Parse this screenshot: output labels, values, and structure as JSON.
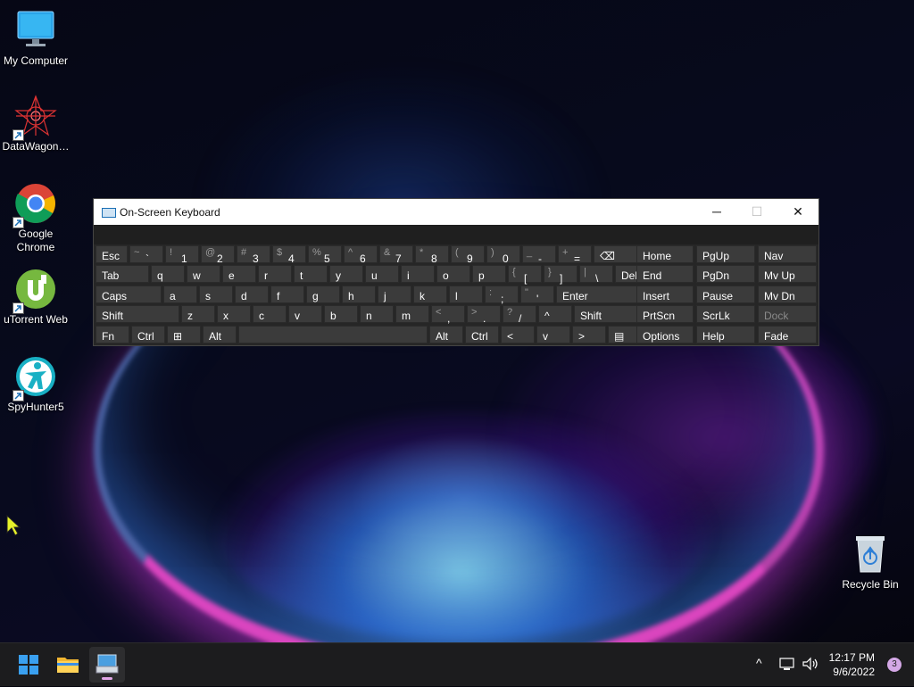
{
  "desktop": {
    "icons": [
      {
        "label": "My Computer",
        "icon": "monitor-icon"
      },
      {
        "label": "DataWagon…",
        "icon": "datawagon-icon"
      },
      {
        "label": "Google Chrome",
        "icon": "chrome-icon"
      },
      {
        "label": "uTorrent Web",
        "icon": "utorrent-icon"
      },
      {
        "label": "SpyHunter5",
        "icon": "spyhunter-icon"
      },
      {
        "label": "Recycle Bin",
        "icon": "recycle-bin-icon"
      }
    ]
  },
  "osk": {
    "title": "On-Screen Keyboard",
    "controls": {
      "minimize": "─",
      "maximize": "☐",
      "close": "✕"
    },
    "rows": {
      "r1": [
        {
          "label": "Esc"
        },
        {
          "shift": "~",
          "main": "`"
        },
        {
          "shift": "!",
          "main": "1"
        },
        {
          "shift": "@",
          "main": "2"
        },
        {
          "shift": "#",
          "main": "3"
        },
        {
          "shift": "$",
          "main": "4"
        },
        {
          "shift": "%",
          "main": "5"
        },
        {
          "shift": "^",
          "main": "6"
        },
        {
          "shift": "&",
          "main": "7"
        },
        {
          "shift": "*",
          "main": "8"
        },
        {
          "shift": "(",
          "main": "9"
        },
        {
          "shift": ")",
          "main": "0"
        },
        {
          "shift": "_",
          "main": "-"
        },
        {
          "shift": "+",
          "main": "="
        },
        {
          "label": "⌫"
        }
      ],
      "r2": [
        {
          "label": "Tab"
        },
        {
          "label": "q"
        },
        {
          "label": "w"
        },
        {
          "label": "e"
        },
        {
          "label": "r"
        },
        {
          "label": "t"
        },
        {
          "label": "y"
        },
        {
          "label": "u"
        },
        {
          "label": "i"
        },
        {
          "label": "o"
        },
        {
          "label": "p"
        },
        {
          "shift": "{",
          "main": "["
        },
        {
          "shift": "}",
          "main": "]"
        },
        {
          "shift": "|",
          "main": "\\"
        },
        {
          "label": "Del"
        }
      ],
      "r3": [
        {
          "label": "Caps"
        },
        {
          "label": "a"
        },
        {
          "label": "s"
        },
        {
          "label": "d"
        },
        {
          "label": "f"
        },
        {
          "label": "g"
        },
        {
          "label": "h"
        },
        {
          "label": "j"
        },
        {
          "label": "k"
        },
        {
          "label": "l"
        },
        {
          "shift": ":",
          "main": ";"
        },
        {
          "shift": "\"",
          "main": "'"
        },
        {
          "label": "Enter"
        }
      ],
      "r4": [
        {
          "label": "Shift"
        },
        {
          "label": "z"
        },
        {
          "label": "x"
        },
        {
          "label": "c"
        },
        {
          "label": "v"
        },
        {
          "label": "b"
        },
        {
          "label": "n"
        },
        {
          "label": "m"
        },
        {
          "shift": "<",
          "main": ","
        },
        {
          "shift": ">",
          "main": "."
        },
        {
          "shift": "?",
          "main": "/"
        },
        {
          "label": "^"
        },
        {
          "label": "Shift"
        }
      ],
      "r5": [
        {
          "label": "Fn"
        },
        {
          "label": "Ctrl"
        },
        {
          "label": "⊞"
        },
        {
          "label": "Alt"
        },
        {
          "label": ""
        },
        {
          "label": "Alt"
        },
        {
          "label": "Ctrl"
        },
        {
          "label": "<"
        },
        {
          "label": "v"
        },
        {
          "label": ">"
        },
        {
          "label": "▤"
        }
      ]
    },
    "nav": {
      "c1": [
        "Home",
        "End",
        "Insert",
        "PrtScn",
        "Options"
      ],
      "c2": [
        "PgUp",
        "PgDn",
        "Pause",
        "ScrLk",
        "Help"
      ],
      "c3": [
        "Nav",
        "Mv Up",
        "Mv Dn",
        "Dock",
        "Fade"
      ]
    }
  },
  "taskbar": {
    "time": "12:17 PM",
    "date": "9/6/2022",
    "badge": "3",
    "tray_chevron": "^"
  }
}
